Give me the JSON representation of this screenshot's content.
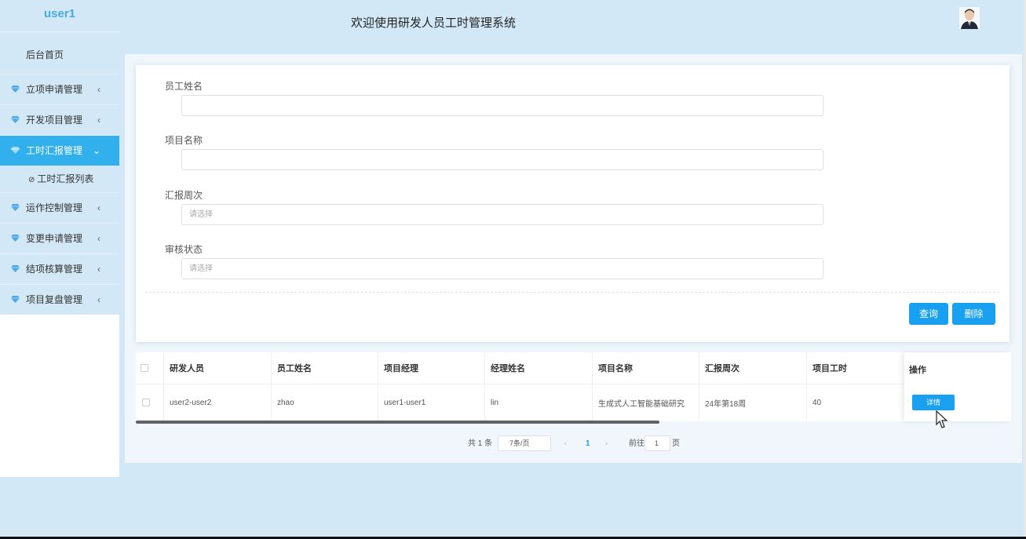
{
  "header": {
    "title": "欢迎使用研发人员工时管理系统"
  },
  "sidebar": {
    "user": "user1",
    "home": "后台首页",
    "items": [
      {
        "label": "立项申请管理",
        "arrow": "‹"
      },
      {
        "label": "开发项目管理",
        "arrow": "‹"
      },
      {
        "label": "工时汇报管理",
        "arrow": "⌄"
      },
      {
        "label": "运作控制管理",
        "arrow": "‹"
      },
      {
        "label": "变更申请管理",
        "arrow": "‹"
      },
      {
        "label": "结项核算管理",
        "arrow": "‹"
      },
      {
        "label": "项目复盘管理",
        "arrow": "‹"
      }
    ],
    "submenu": {
      "label": "工时汇报列表",
      "icon": "clock-icon"
    },
    "colors": {
      "active": "#32b0ee",
      "gem": "#4aa8e8"
    }
  },
  "search": {
    "fields": [
      {
        "label": "员工姓名",
        "placeholder": ""
      },
      {
        "label": "项目名称",
        "placeholder": ""
      },
      {
        "label": "汇报周次",
        "placeholder": "请选择"
      },
      {
        "label": "审核状态",
        "placeholder": "请选择"
      }
    ],
    "query_button": "查询",
    "delete_button": "删除"
  },
  "table": {
    "columns": [
      "研发人员",
      "员工姓名",
      "项目经理",
      "经理姓名",
      "项目名称",
      "汇报周次",
      "项目工时",
      "操作"
    ],
    "rows": [
      [
        "user2-user2",
        "zhao",
        "user1-user1",
        "lin",
        "生成式人工智能基础研究",
        "24年第18周",
        "40"
      ]
    ],
    "detail_button": "详情"
  },
  "pagination": {
    "total": "共 1 条",
    "page_size": "7条/页",
    "prev": "‹",
    "current_page": "1",
    "next": "›",
    "goto_label": "前往",
    "goto_value": "1",
    "page_suffix": "页"
  }
}
